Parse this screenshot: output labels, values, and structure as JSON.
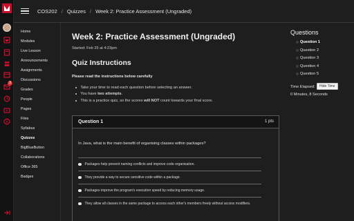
{
  "breadcrumb": {
    "course": "COS202",
    "section": "Quizzes",
    "page": "Week 2: Practice Assessment (Ungraded)"
  },
  "global_nav": {
    "icons": [
      "logo",
      "avatar",
      "dashboard-icon",
      "courses-icon",
      "groups-icon",
      "calendar-icon",
      "inbox-icon",
      "history-icon",
      "studio-icon",
      "help-icon",
      "collapse-icon"
    ],
    "inbox_badge": "3",
    "accent": "#c8102e"
  },
  "course_nav": {
    "items": [
      "Home",
      "Modules",
      "Live Lesson",
      "Announcements",
      "Assignments",
      "Discussions",
      "Grades",
      "People",
      "Pages",
      "Files",
      "Syllabus",
      "Quizzes",
      "BigBlueButton",
      "Collaborations",
      "Office 365",
      "Badges"
    ],
    "active": "Quizzes"
  },
  "quiz": {
    "title": "Week 2: Practice Assessment (Ungraded)",
    "started": "Started: Feb 25 at 4:23pm",
    "instructions_heading": "Quiz Instructions",
    "instructions_lead": "Please read the instructions below carefully",
    "instructions": [
      "Take your time to read each question before selecting an answer.",
      "You have two attempts.",
      "This is a practice quiz, so the scores will NOT count towards your final score."
    ]
  },
  "question": {
    "title": "Question 1",
    "points": "1 pts",
    "text": "In Java, what is the main benefit of organising classes within packages?",
    "answers": [
      "Packages help prevent naming conflicts and improve code organisation.",
      "They provide a way to secure sensitive code within a package.",
      "Packages improve the program's execution speed by reducing memory usage.",
      "They allow all classes in the same package to access each other's members freely without access modifiers."
    ]
  },
  "sidebar": {
    "heading": "Questions",
    "questions": [
      "Question 1",
      "Question 2",
      "Question 3",
      "Question 4",
      "Question 5"
    ],
    "current": "Question 1",
    "time_label": "Time Elapsed:",
    "hide_time_label": "Hide Time",
    "time_value": "0 Minutes, 8 Seconds"
  }
}
